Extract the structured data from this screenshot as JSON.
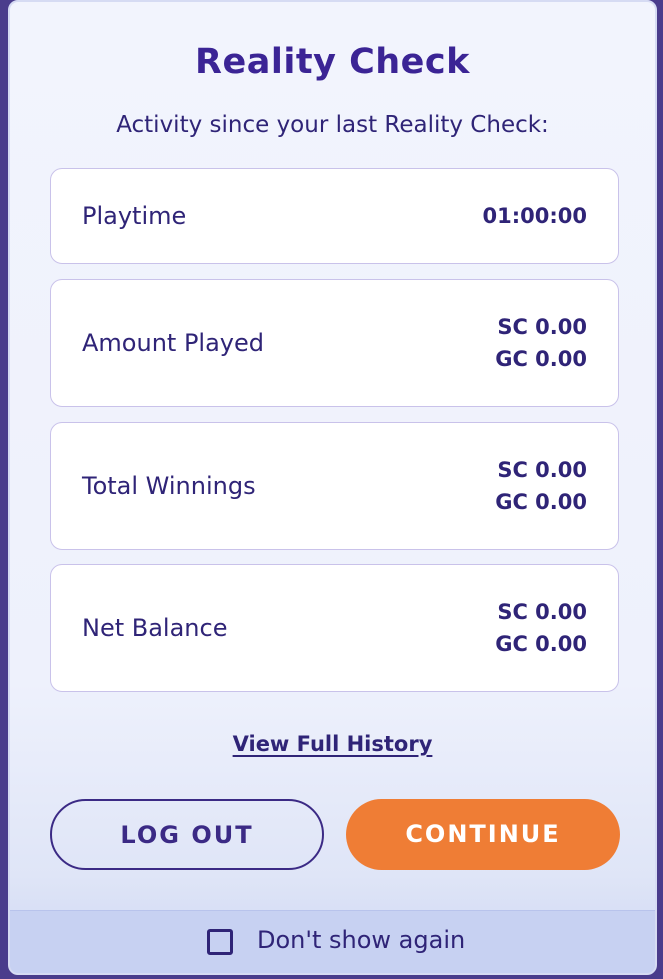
{
  "modal": {
    "title": "Reality Check",
    "subtitle": "Activity since your last Reality Check:"
  },
  "stats": [
    {
      "label": "Playtime",
      "values": [
        "01:00:00"
      ]
    },
    {
      "label": "Amount Played",
      "values": [
        "SC 0.00",
        "GC 0.00"
      ]
    },
    {
      "label": "Total Winnings",
      "values": [
        "SC 0.00",
        "GC 0.00"
      ]
    },
    {
      "label": "Net Balance",
      "values": [
        "SC 0.00",
        "GC 0.00"
      ]
    }
  ],
  "links": {
    "history": "View Full History"
  },
  "buttons": {
    "logout": "LOG OUT",
    "continue": "CONTINUE"
  },
  "footer": {
    "dont_show_label": "Don't show again",
    "dont_show_checked": false
  },
  "colors": {
    "primary_text": "#2f2477",
    "title": "#3b2495",
    "accent": "#ef7d35",
    "card_border": "#c9c2ea"
  }
}
